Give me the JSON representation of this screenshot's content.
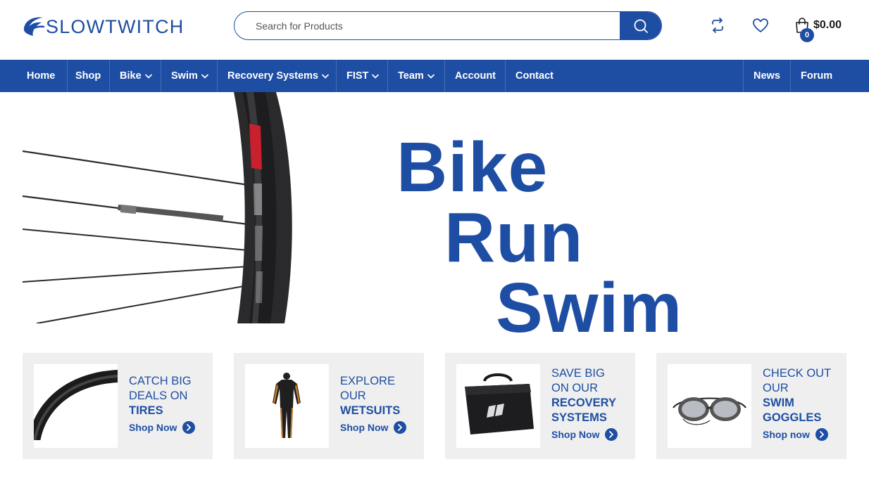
{
  "brand": {
    "logo_text": "SLOWTWITCH",
    "accent": "#1e4ea3"
  },
  "search": {
    "placeholder": "Search for Products",
    "value": ""
  },
  "header_icons": [
    "compare-icon",
    "wishlist-heart-icon",
    "shopping-bag-icon"
  ],
  "cart": {
    "count": "0",
    "total": "$0.00"
  },
  "nav": {
    "items": [
      {
        "label": "Home",
        "has_dropdown": false
      },
      {
        "label": "Shop",
        "has_dropdown": false
      },
      {
        "label": "Bike",
        "has_dropdown": true
      },
      {
        "label": "Swim",
        "has_dropdown": true
      },
      {
        "label": "Recovery Systems",
        "has_dropdown": true
      },
      {
        "label": "FIST",
        "has_dropdown": true
      },
      {
        "label": "Team",
        "has_dropdown": true
      },
      {
        "label": "Account",
        "has_dropdown": false
      },
      {
        "label": "Contact",
        "has_dropdown": false
      }
    ],
    "right_items": [
      {
        "label": "News"
      },
      {
        "label": "Forum"
      }
    ]
  },
  "hero": {
    "words": [
      "Bike",
      "Run",
      "Swim"
    ]
  },
  "promos": [
    {
      "lines": [
        "CATCH BIG",
        "DEALS ON"
      ],
      "highlight": [
        "TIRES"
      ],
      "cta": "Shop Now",
      "image": "bicycle tire"
    },
    {
      "lines": [
        "EXPLORE",
        "OUR"
      ],
      "highlight": [
        "WETSUITS"
      ],
      "cta": "Shop Now",
      "image": "wetsuit"
    },
    {
      "lines": [
        "SAVE BIG",
        "ON OUR"
      ],
      "highlight": [
        "RECOVERY",
        "SYSTEMS"
      ],
      "cta": "Shop Now",
      "image": "recovery system bag"
    },
    {
      "lines": [
        "CHECK OUT",
        "OUR"
      ],
      "highlight": [
        "SWIM",
        "GOGGLES"
      ],
      "cta": "Shop now",
      "image": "swim goggles"
    }
  ]
}
